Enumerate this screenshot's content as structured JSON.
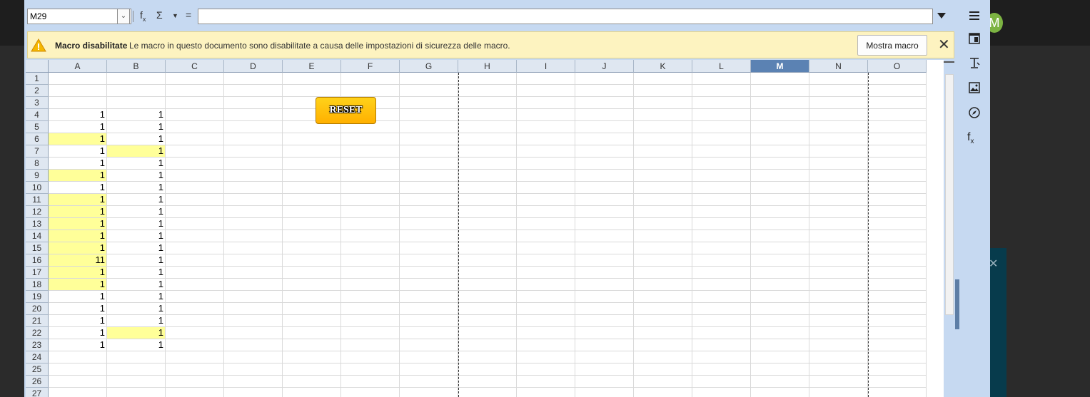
{
  "formula_bar": {
    "name_box": "M29",
    "formula": ""
  },
  "infobar": {
    "title": "Macro disabilitate",
    "message": "Le macro in questo documento sono disabilitate a causa delle impostazioni di sicurezza delle macro.",
    "button": "Mostra macro"
  },
  "sheet": {
    "columns": [
      "A",
      "B",
      "C",
      "D",
      "E",
      "F",
      "G",
      "H",
      "I",
      "J",
      "K",
      "L",
      "M",
      "N",
      "O"
    ],
    "selected_column": "M",
    "rows": [
      {
        "n": "1",
        "a": "",
        "b": "",
        "a_hl": false,
        "b_hl": false
      },
      {
        "n": "2",
        "a": "",
        "b": "",
        "a_hl": false,
        "b_hl": false
      },
      {
        "n": "3",
        "a": "",
        "b": "",
        "a_hl": false,
        "b_hl": false
      },
      {
        "n": "4",
        "a": "1",
        "b": "1",
        "a_hl": false,
        "b_hl": false
      },
      {
        "n": "5",
        "a": "1",
        "b": "1",
        "a_hl": false,
        "b_hl": false
      },
      {
        "n": "6",
        "a": "1",
        "b": "1",
        "a_hl": true,
        "b_hl": false
      },
      {
        "n": "7",
        "a": "1",
        "b": "1",
        "a_hl": false,
        "b_hl": true
      },
      {
        "n": "8",
        "a": "1",
        "b": "1",
        "a_hl": false,
        "b_hl": false
      },
      {
        "n": "9",
        "a": "1",
        "b": "1",
        "a_hl": true,
        "b_hl": false
      },
      {
        "n": "10",
        "a": "1",
        "b": "1",
        "a_hl": false,
        "b_hl": false
      },
      {
        "n": "11",
        "a": "1",
        "b": "1",
        "a_hl": true,
        "b_hl": false
      },
      {
        "n": "12",
        "a": "1",
        "b": "1",
        "a_hl": true,
        "b_hl": false
      },
      {
        "n": "13",
        "a": "1",
        "b": "1",
        "a_hl": true,
        "b_hl": false
      },
      {
        "n": "14",
        "a": "1",
        "b": "1",
        "a_hl": true,
        "b_hl": false
      },
      {
        "n": "15",
        "a": "1",
        "b": "1",
        "a_hl": true,
        "b_hl": false
      },
      {
        "n": "16",
        "a": "11",
        "b": "1",
        "a_hl": true,
        "b_hl": false
      },
      {
        "n": "17",
        "a": "1",
        "b": "1",
        "a_hl": true,
        "b_hl": false
      },
      {
        "n": "18",
        "a": "1",
        "b": "1",
        "a_hl": true,
        "b_hl": false
      },
      {
        "n": "19",
        "a": "1",
        "b": "1",
        "a_hl": false,
        "b_hl": false
      },
      {
        "n": "20",
        "a": "1",
        "b": "1",
        "a_hl": false,
        "b_hl": false
      },
      {
        "n": "21",
        "a": "1",
        "b": "1",
        "a_hl": false,
        "b_hl": false
      },
      {
        "n": "22",
        "a": "1",
        "b": "1",
        "a_hl": false,
        "b_hl": true
      },
      {
        "n": "23",
        "a": "1",
        "b": "1",
        "a_hl": false,
        "b_hl": false
      },
      {
        "n": "24",
        "a": "",
        "b": "",
        "a_hl": false,
        "b_hl": false
      },
      {
        "n": "25",
        "a": "",
        "b": "",
        "a_hl": false,
        "b_hl": false
      },
      {
        "n": "26",
        "a": "",
        "b": "",
        "a_hl": false,
        "b_hl": false
      },
      {
        "n": "27",
        "a": "",
        "b": "",
        "a_hl": false,
        "b_hl": false
      }
    ],
    "reset_button": "RESET"
  },
  "sidebar": {
    "icons": [
      "hamburger-menu-icon",
      "properties-icon",
      "styles-icon",
      "gallery-icon",
      "navigator-icon",
      "functions-icon"
    ]
  },
  "colors": {
    "highlight": "#ffff99",
    "chrome": "#c6d9f1",
    "selected_header": "#5b82b3",
    "infobar": "#fdf3c0",
    "reset_button": "#ffc107"
  }
}
